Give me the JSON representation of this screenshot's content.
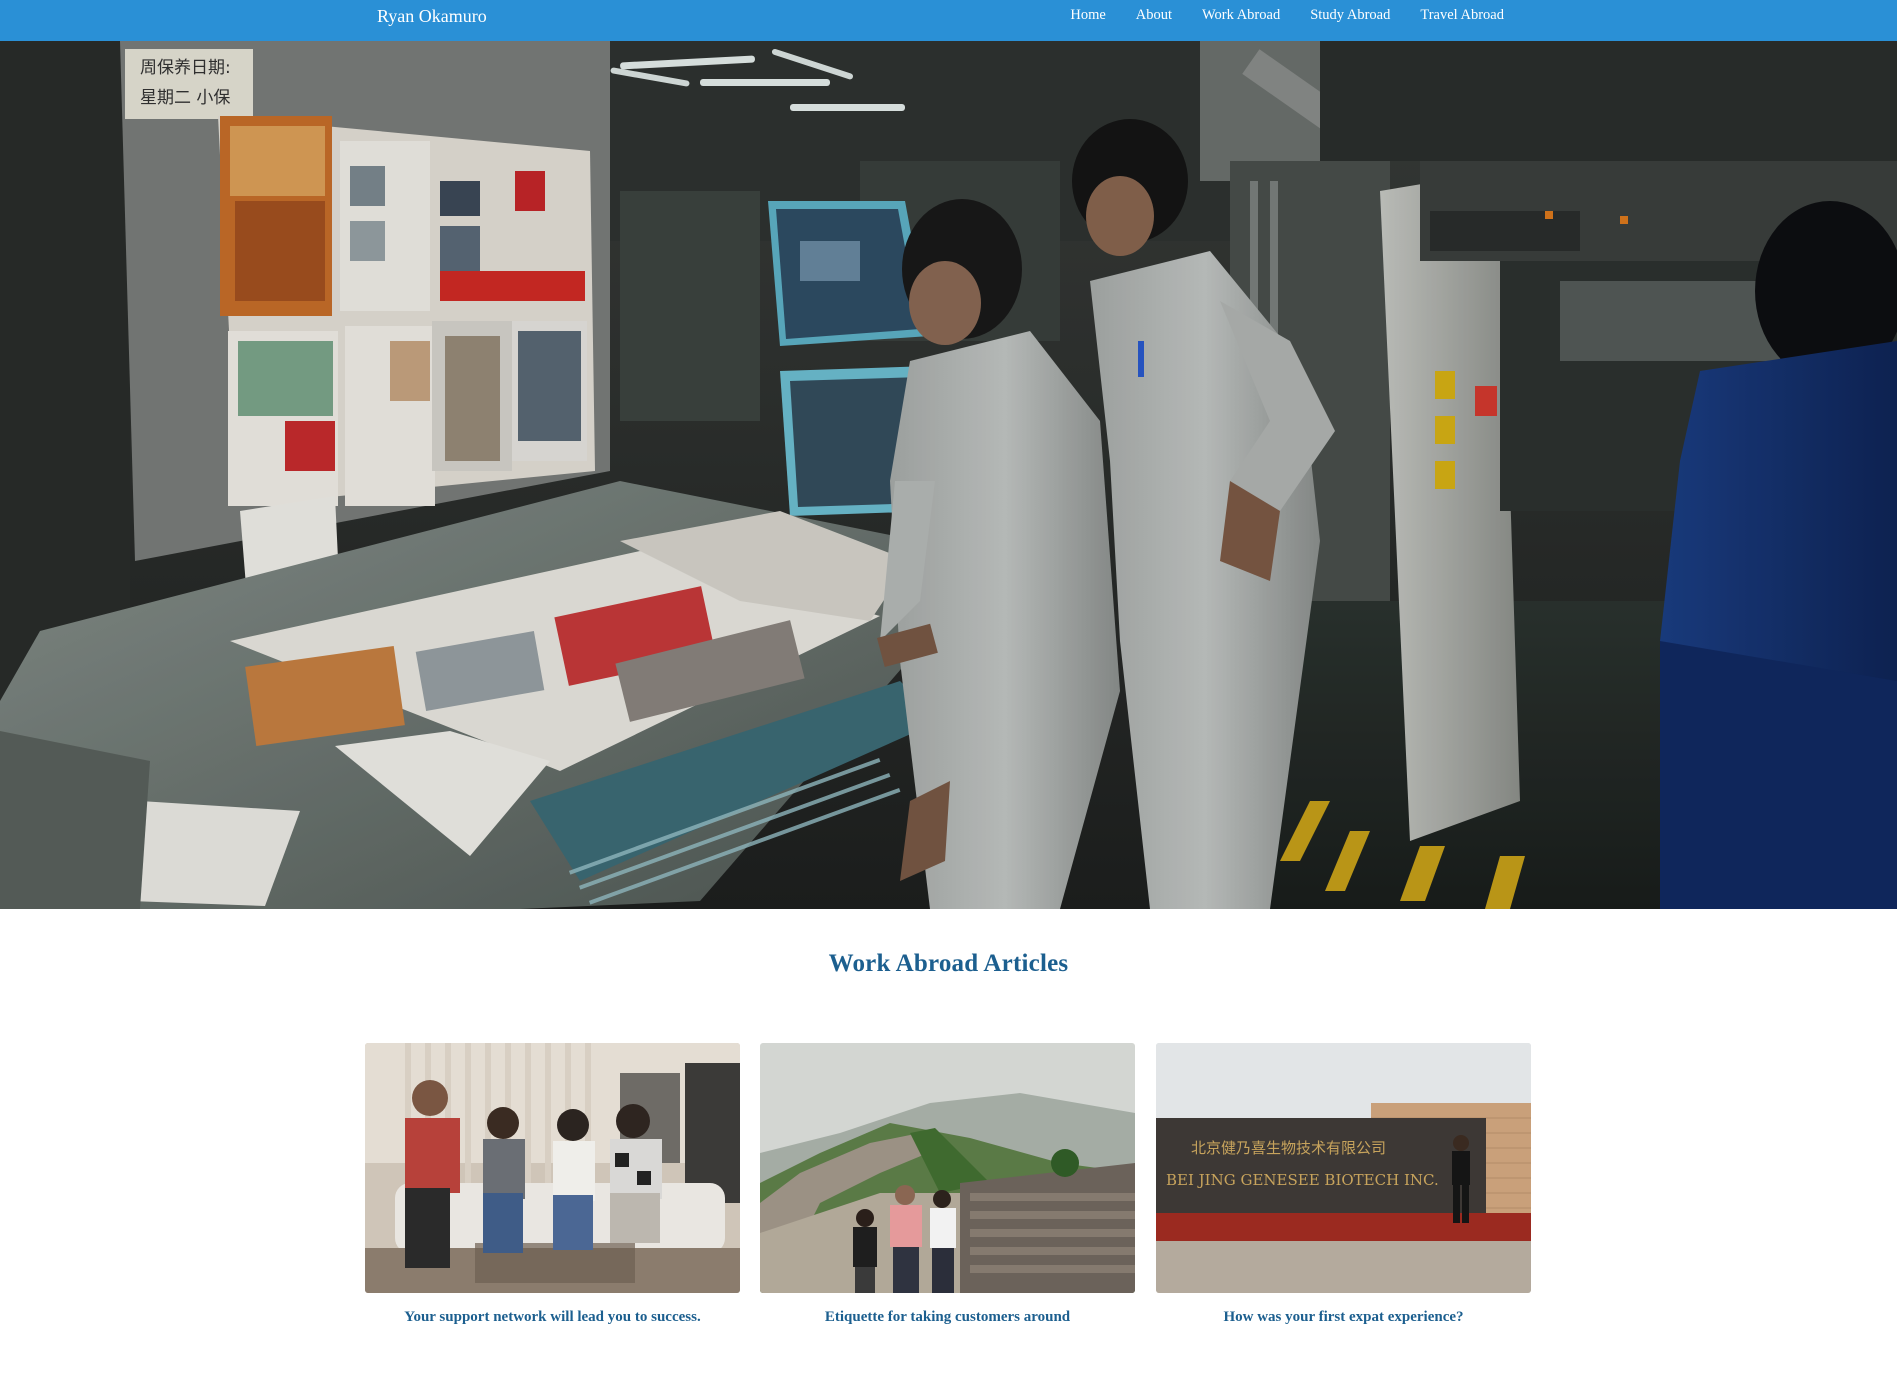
{
  "navbar": {
    "brand": "Ryan Okamuro",
    "links": [
      "Home",
      "About",
      "Work Abroad",
      "Study Abroad",
      "Travel Abroad"
    ]
  },
  "hero": {
    "image": "printing-press-workers-photo"
  },
  "articles": {
    "title": "Work Abroad Articles",
    "cards": [
      {
        "title": "Your support network will lead you to success.",
        "image": "friends-on-sofa-photo"
      },
      {
        "title": "Etiquette for taking customers around",
        "image": "great-wall-photo"
      },
      {
        "title": "How was your first expat experience?",
        "image": "biotech-company-sign-photo",
        "sign_lines": [
          "北京健乃喜生物技术有限公司",
          "BEI JING GENESEE BIOTECH INC."
        ]
      }
    ]
  },
  "colors": {
    "navbar": "#2a90d6",
    "heading": "#1c5f8f"
  }
}
